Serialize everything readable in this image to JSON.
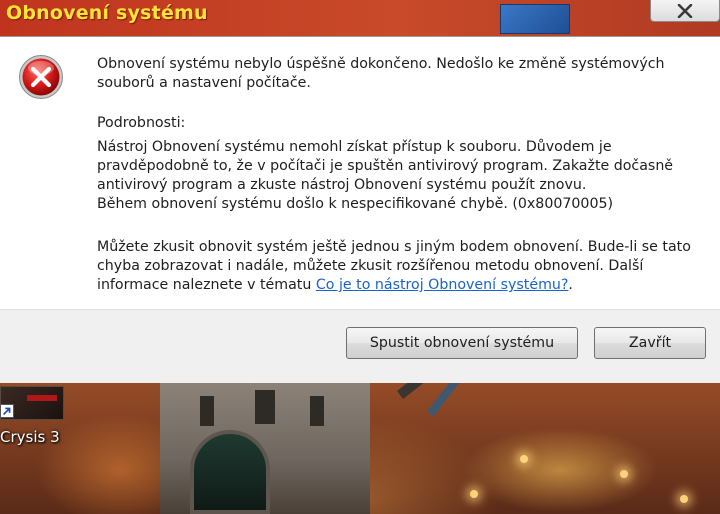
{
  "window": {
    "title": "Obnovení systému"
  },
  "icons": {
    "error": "error-icon",
    "close": "close-icon",
    "shortcut": "shortcut-arrow-icon"
  },
  "message": {
    "intro_lines": [
      "Obnovení systému nebylo úspěšně dokončeno. Nedošlo ke změně systémových",
      "souborů a nastavení počítače."
    ],
    "details_heading": "Podrobnosti:",
    "details_lines": [
      "Nástroj Obnovení systému nemohl získat přístup k souboru. Důvodem je",
      "pravděpodobně to, že v počítači je spuštěn antivirový program. Zakažte dočasně",
      "antivirový program a zkuste nástroj Obnovení systému použít znovu.",
      "Během obnovení systému došlo k nespecifikované chybě. (0x80070005)"
    ],
    "suggestion_lines": [
      "Můžete zkusit obnovit systém ještě jednou s jiným bodem obnovení. Bude-li se tato",
      "chyba zobrazovat i nadále, můžete zkusit rozšířenou metodu obnovení. Další"
    ],
    "suggestion_last_prefix": "informace naleznete v tématu ",
    "help_link": "Co je to nástroj Obnovení systému?",
    "suggestion_last_suffix": "."
  },
  "buttons": {
    "restore": "Spustit obnovení systému",
    "close": "Zavřít"
  },
  "desktop": {
    "shortcut_label": "Crysis 3"
  },
  "colors": {
    "title_text": "#ffe23a",
    "link": "#1a63c8",
    "error_red": "#d01818"
  }
}
